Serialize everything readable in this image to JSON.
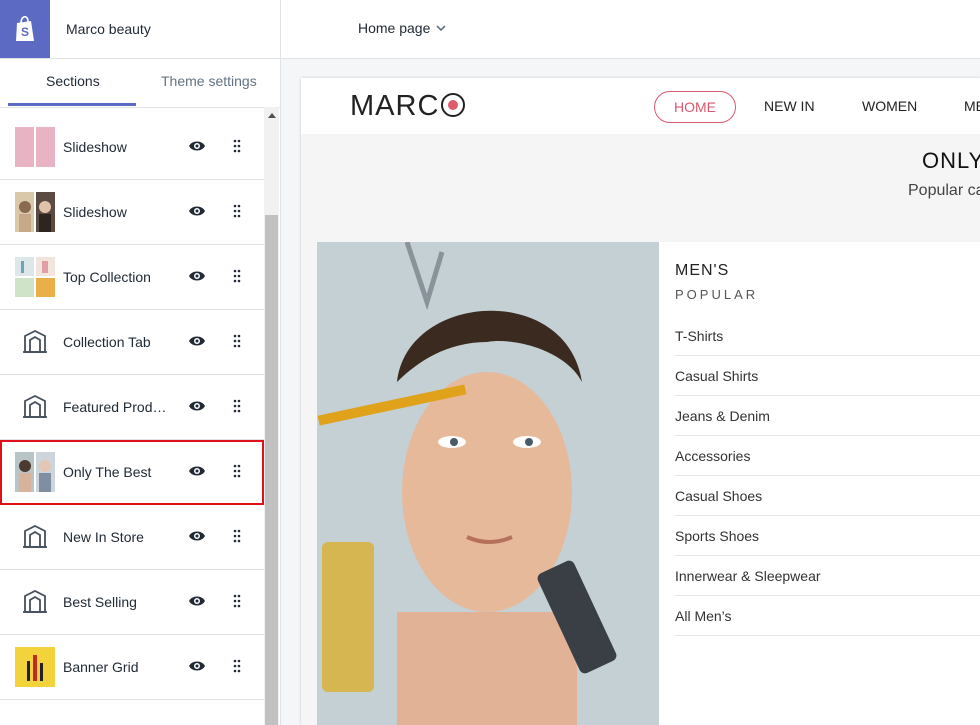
{
  "store": {
    "name": "Marco beauty"
  },
  "page_selector": {
    "label": "Home page"
  },
  "tabs": [
    {
      "label": "Sections"
    },
    {
      "label": "Theme settings"
    }
  ],
  "sections": [
    {
      "label": "Slideshow",
      "icon": "pink-slideshow-thumbnail"
    },
    {
      "label": "Slideshow",
      "icon": "portrait-slideshow-thumbnail"
    },
    {
      "label": "Top Collection",
      "icon": "collection-thumbnail"
    },
    {
      "label": "Collection Tab",
      "icon": "section-template-icon"
    },
    {
      "label": "Featured Produ…",
      "icon": "section-template-icon"
    },
    {
      "label": "Only The Best",
      "icon": "portrait-thumbnail"
    },
    {
      "label": "New In Store",
      "icon": "section-template-icon"
    },
    {
      "label": "Best Selling",
      "icon": "section-template-icon"
    },
    {
      "label": "Banner Grid",
      "icon": "banner-thumbnail"
    }
  ],
  "preview": {
    "brand": "MARC",
    "nav": [
      {
        "label": "HOME"
      },
      {
        "label": "NEW IN"
      },
      {
        "label": "WOMEN"
      },
      {
        "label": "ME"
      }
    ],
    "section_title": "ONLY",
    "section_subtitle": "Popular ca",
    "menu": {
      "title": "MEN'S",
      "subtitle": "POPULAR",
      "items": [
        "T-Shirts",
        "Casual Shirts",
        "Jeans & Denim",
        "Accessories",
        "Casual Shoes",
        "Sports Shoes",
        "Innerwear & Sleepwear",
        "All Men’s"
      ]
    }
  },
  "colors": {
    "accent": "#5c6ac4",
    "highlight": "#e0101b",
    "brand_pink": "#d9586d"
  }
}
